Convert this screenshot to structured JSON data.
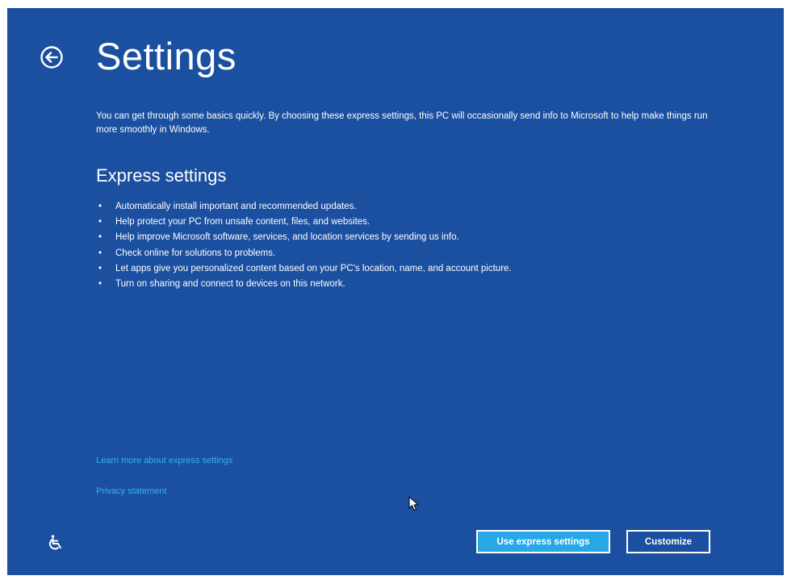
{
  "page": {
    "title": "Settings",
    "intro": "You can get through some basics quickly. By choosing these express settings, this PC will occasionally send info to Microsoft to help make things run more smoothly in Windows.",
    "section_heading": "Express settings",
    "bullets": [
      "Automatically install important and recommended updates.",
      "Help protect your PC from unsafe content, files, and websites.",
      "Help improve Microsoft software, services, and location services by sending us info.",
      "Check online for solutions to problems.",
      "Let apps give you personalized content based on your PC's location, name, and account picture.",
      "Turn on sharing and connect to devices on this network."
    ],
    "bullet_glyph": "•"
  },
  "links": {
    "learn_more": "Learn more about express settings",
    "privacy": "Privacy statement"
  },
  "buttons": {
    "express": "Use express settings",
    "customize": "Customize"
  },
  "icons": {
    "back": "back-arrow-circle-icon",
    "ease_of_access": "ease-of-access-icon",
    "cursor": "mouse-pointer-icon"
  },
  "colors": {
    "background": "#1b4fa0",
    "link": "#32b4ea",
    "primary_button": "#28a7e6"
  }
}
